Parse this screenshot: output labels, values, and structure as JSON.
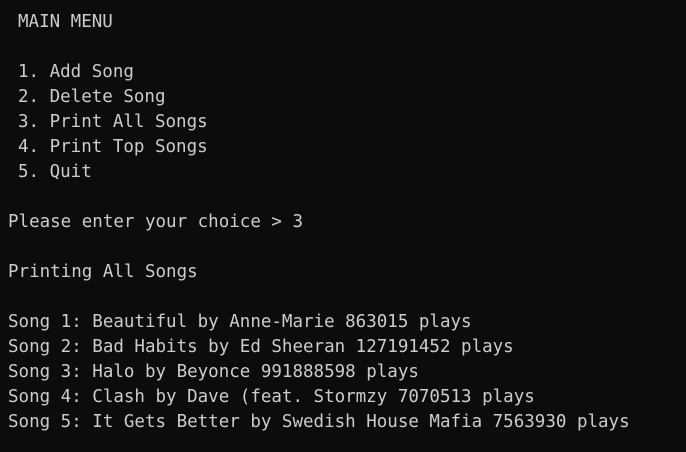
{
  "menu": {
    "title": "MAIN MENU",
    "items": [
      "1. Add Song",
      "2. Delete Song",
      "3. Print All Songs",
      "4. Print Top Songs",
      "5. Quit"
    ]
  },
  "prompt": {
    "text": "Please enter your choice > 3"
  },
  "status": {
    "heading": "Printing All Songs"
  },
  "songs": [
    "Song 1: Beautiful by Anne-Marie 863015 plays",
    "Song 2: Bad Habits by Ed Sheeran 127191452 plays",
    "Song 3: Halo by Beyonce 991888598 plays",
    "Song 4: Clash by Dave (feat. Stormzy 7070513 plays",
    "Song 5: It Gets Better by Swedish House Mafia 7563930 plays"
  ]
}
